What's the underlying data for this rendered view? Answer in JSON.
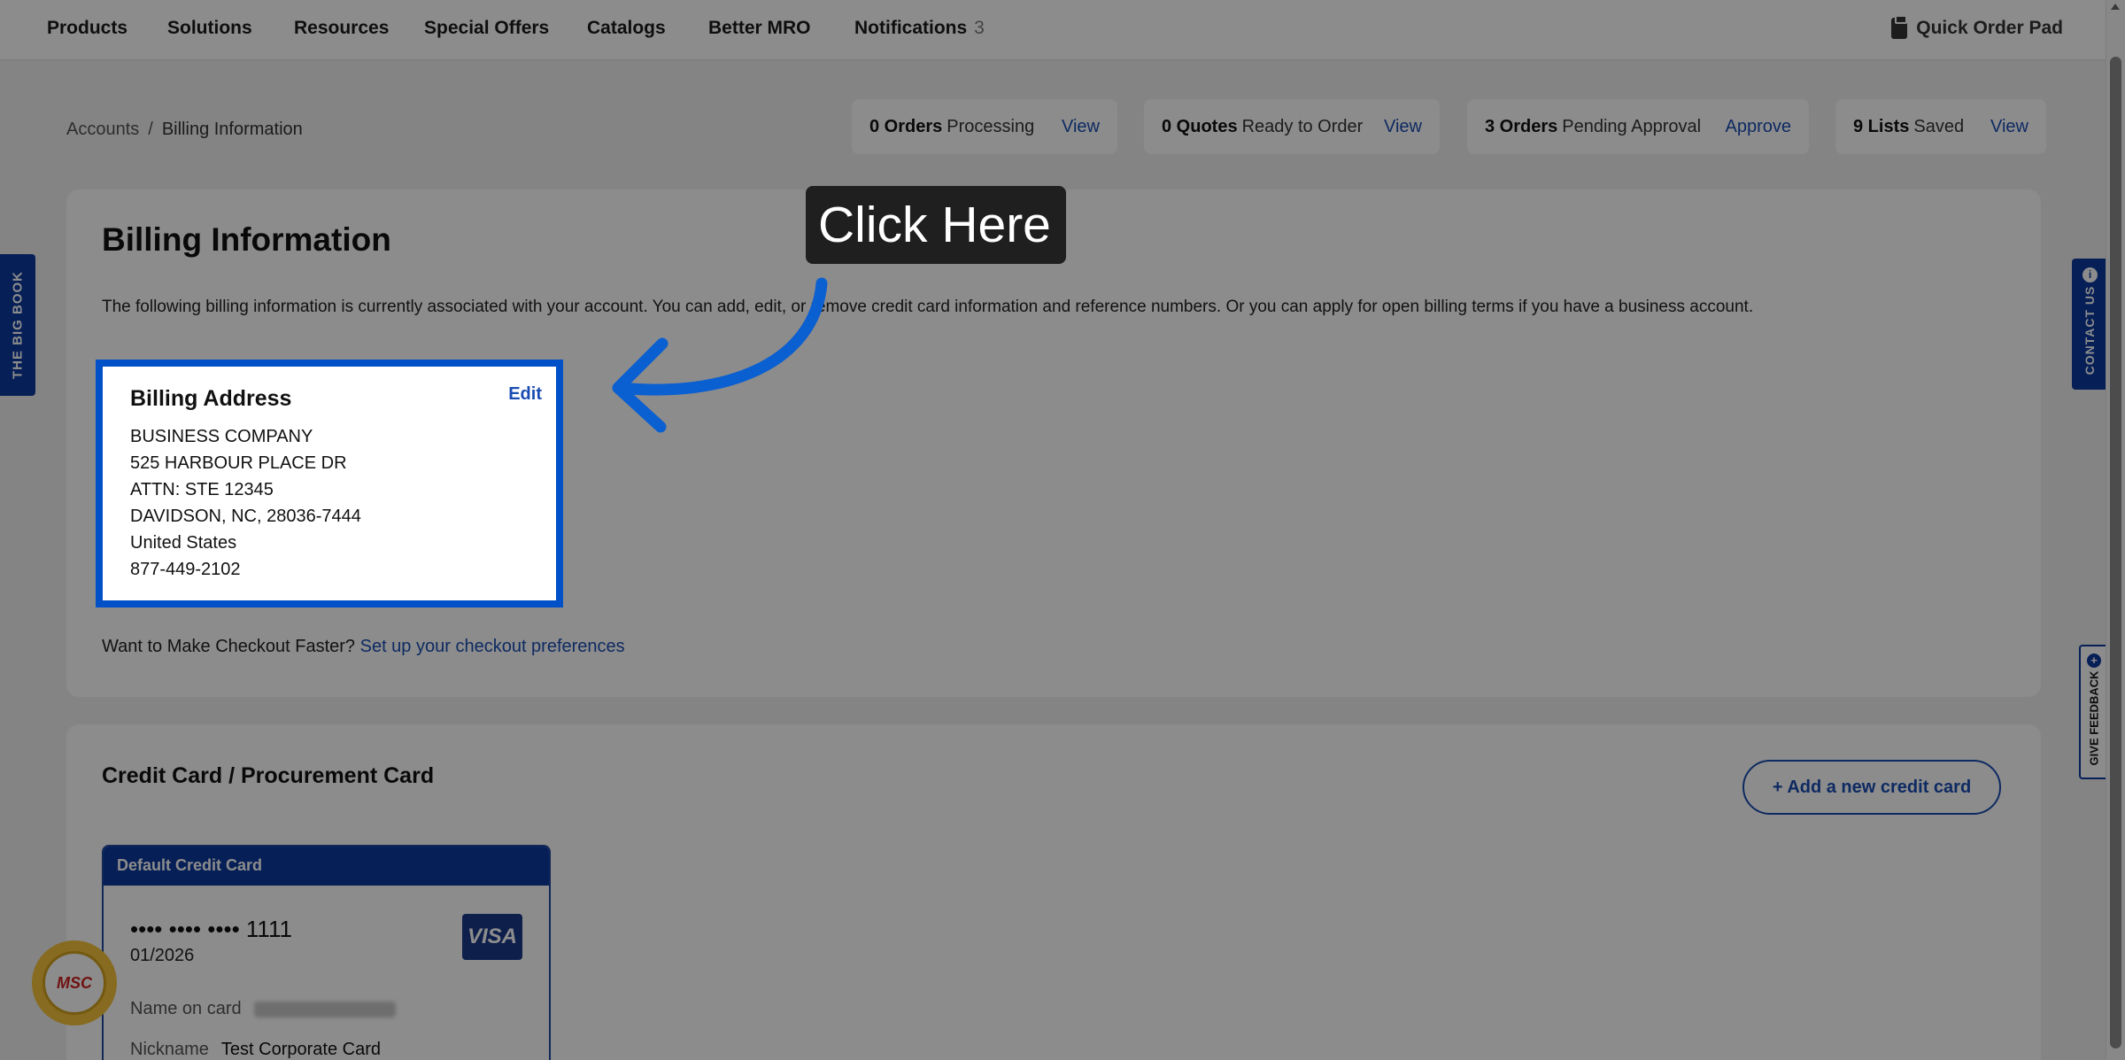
{
  "nav": {
    "items": [
      "Products",
      "Solutions",
      "Resources",
      "Special Offers",
      "Catalogs",
      "Better MRO",
      "Notifications"
    ],
    "notifications_count": "3",
    "quick_order": "Quick Order Pad"
  },
  "breadcrumb": {
    "parent": "Accounts",
    "separator": "/",
    "current": "Billing Information"
  },
  "summary": [
    {
      "count": "0 Orders",
      "label": "Processing",
      "action": "View"
    },
    {
      "count": "0 Quotes",
      "label": "Ready to Order",
      "action": "View"
    },
    {
      "count": "3 Orders",
      "label": "Pending Approval",
      "action": "Approve"
    },
    {
      "count": "9 Lists",
      "label": "Saved",
      "action": "View"
    }
  ],
  "billing": {
    "title": "Billing Information",
    "intro": "The following billing information is currently associated with your account. You can add, edit, or remove credit card information and reference numbers. Or you can apply for open billing terms if you have a business account.",
    "address_title": "Billing Address",
    "edit_label": "Edit",
    "address_lines": [
      "BUSINESS COMPANY",
      "525 HARBOUR PLACE DR",
      "ATTN: STE 12345",
      "DAVIDSON, NC, 28036-7444",
      "United States",
      "877-449-2102"
    ],
    "checkout_prompt": "Want to Make Checkout Faster?",
    "checkout_link": "Set up your checkout preferences"
  },
  "credit": {
    "title": "Credit Card / Procurement Card",
    "add_button": "+ Add a new credit card",
    "default_label": "Default Credit Card",
    "card_number": "•••• •••• •••• 1111",
    "expiry": "01/2026",
    "brand": "VISA",
    "name_label": "Name on card",
    "nickname_label": "Nickname",
    "nickname": "Test Corporate Card"
  },
  "side_tabs": {
    "big_book": "THE BIG BOOK",
    "contact": "CONTACT US",
    "feedback": "GIVE FEEDBACK"
  },
  "chat_logo": "MSC",
  "tooltip": "Click Here"
}
